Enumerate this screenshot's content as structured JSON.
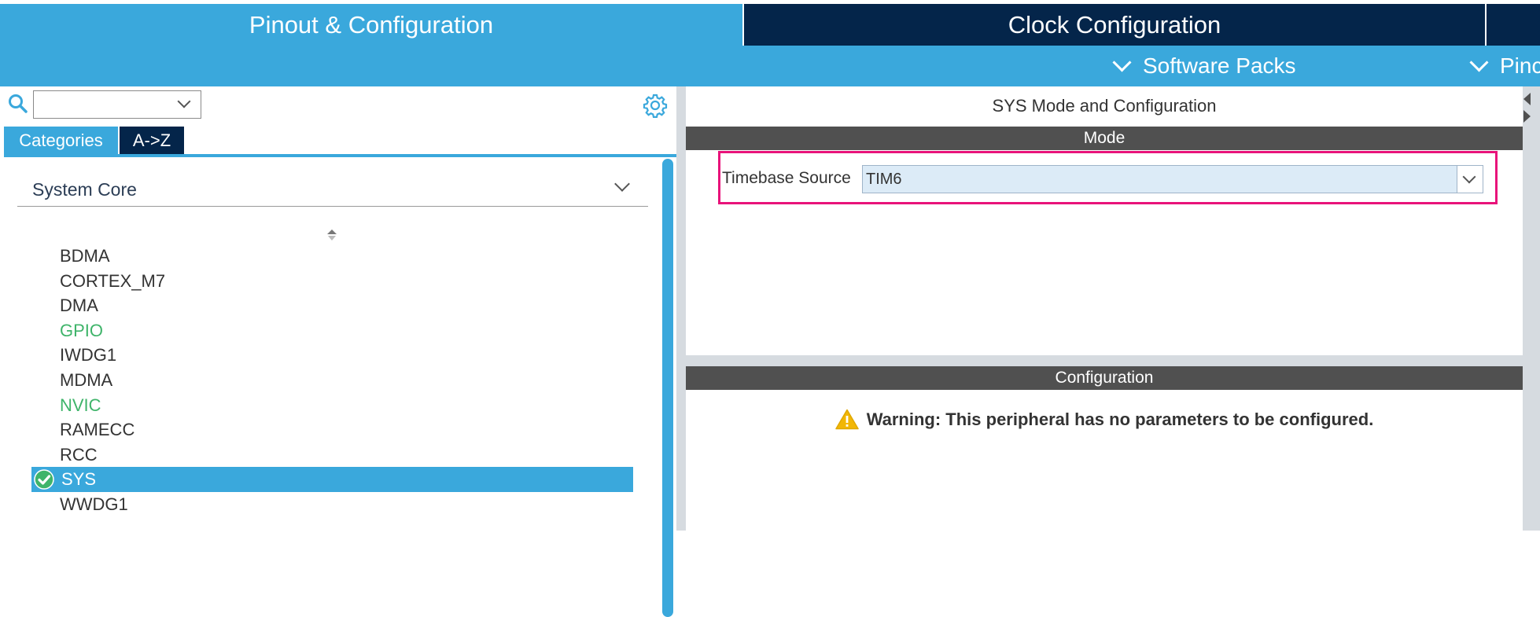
{
  "tabs": {
    "pinout": "Pinout & Configuration",
    "clock": "Clock Configuration"
  },
  "subbar": {
    "software_packs": "Software Packs",
    "pinout_partial": "Pinc"
  },
  "left_panel": {
    "search": {
      "value": "",
      "placeholder": ""
    },
    "view_tabs": {
      "categories": "Categories",
      "az": "A->Z"
    },
    "category_selected": "System Core",
    "items": [
      {
        "label": "BDMA",
        "state": "normal"
      },
      {
        "label": "CORTEX_M7",
        "state": "normal"
      },
      {
        "label": "DMA",
        "state": "normal"
      },
      {
        "label": "GPIO",
        "state": "configured"
      },
      {
        "label": "IWDG1",
        "state": "normal"
      },
      {
        "label": "MDMA",
        "state": "normal"
      },
      {
        "label": "NVIC",
        "state": "configured"
      },
      {
        "label": "RAMECC",
        "state": "normal"
      },
      {
        "label": "RCC",
        "state": "normal"
      },
      {
        "label": "SYS",
        "state": "selected"
      },
      {
        "label": "WWDG1",
        "state": "normal"
      }
    ]
  },
  "right_panel": {
    "title": "SYS Mode and Configuration",
    "mode_header": "Mode",
    "timebase_label": "Timebase Source",
    "timebase_value": "TIM6",
    "config_header": "Configuration",
    "warning": "Warning: This peripheral has no parameters to be configured."
  },
  "icons": {
    "search": "search-icon",
    "gear": "gear-icon",
    "check": "check-circle-icon",
    "warning": "warning-triangle-icon",
    "sort": "sort-icon"
  },
  "colors": {
    "primary_blue": "#3aa8dc",
    "dark_navy": "#04254a",
    "configured_green": "#3fb46a",
    "highlight_pink": "#e8137a",
    "header_gray": "#505050"
  }
}
